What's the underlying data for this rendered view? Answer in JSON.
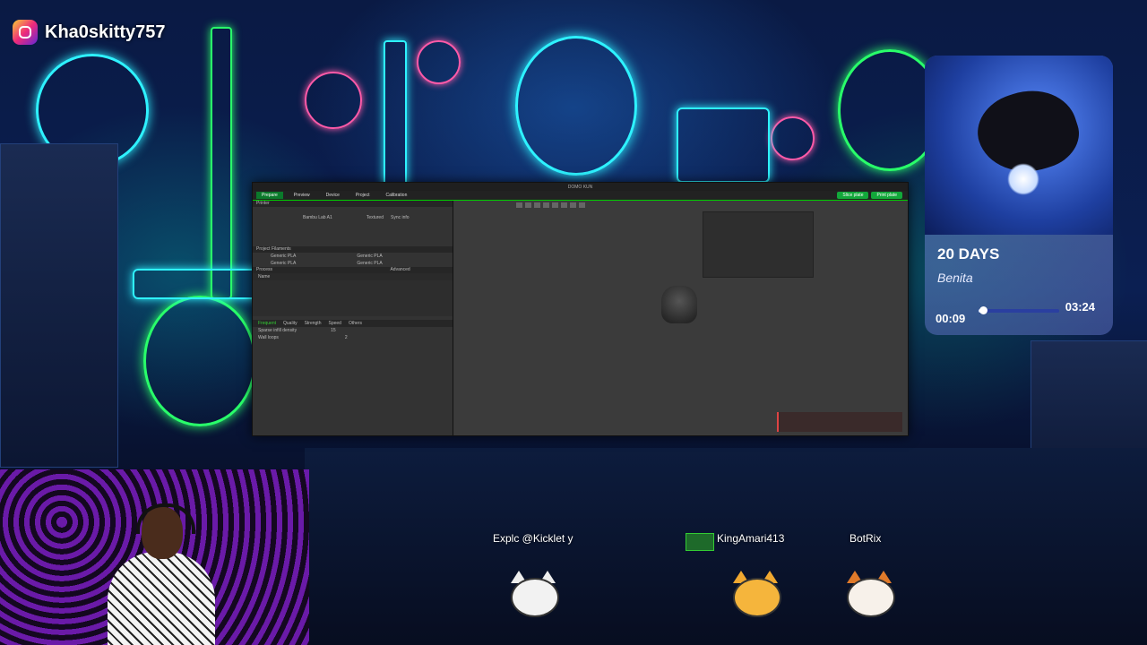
{
  "overlay": {
    "instagram_handle": "Kha0skitty757",
    "instagram_icon": "instagram-icon"
  },
  "app": {
    "title": "DOMO KUN",
    "tabs": [
      "Prepare",
      "Preview",
      "Device",
      "Project",
      "Calibration"
    ],
    "active_tab": "Prepare",
    "actions": [
      "Slice plate",
      "Print plate"
    ],
    "left_sections": {
      "printer": "Printer",
      "printer_name": "Bambu Lab A1",
      "plate": "Textured",
      "sync": "Sync info",
      "project_filaments": "Project Filaments",
      "filament_1": "Generic PLA",
      "filament_2": "Generic PLA",
      "process": "Process",
      "advanced": "Advanced",
      "name_col": "Name",
      "process_tabs": [
        "Frequent",
        "Quality",
        "Strength",
        "Speed",
        "Others"
      ],
      "sparse_infill_label": "Sparse infill density",
      "sparse_infill_value": "15",
      "wall_loops_label": "Wall loops",
      "wall_loops_value": "2"
    }
  },
  "music": {
    "song": "20 DAYS",
    "artist": "Benita",
    "elapsed": "00:09",
    "total": "03:24",
    "progress": 0.05,
    "accent": "#dce6ff"
  },
  "chat_bots": [
    {
      "label": "Explc @Kicklet y"
    },
    {
      "label": "KingAmari413"
    },
    {
      "label": "BotRix"
    }
  ],
  "colors": {
    "neon_cyan": "#2ef2ff",
    "neon_green": "#29ff6a",
    "neon_pink": "#ff5aa8",
    "app_green": "#12a83a"
  }
}
